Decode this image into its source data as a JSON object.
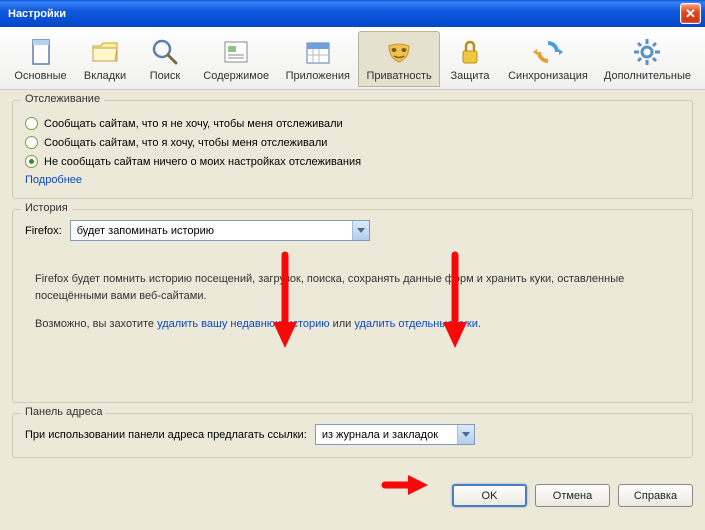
{
  "window": {
    "title": "Настройки"
  },
  "tabs": {
    "main": "Основные",
    "tabsLabel": "Вкладки",
    "search": "Поиск",
    "content": "Содержимое",
    "apps": "Приложения",
    "privacy": "Приватность",
    "security": "Защита",
    "sync": "Синхронизация",
    "advanced": "Дополнительные"
  },
  "tracking": {
    "title": "Отслеживание",
    "opt1": "Сообщать сайтам, что я не хочу, чтобы меня отслеживали",
    "opt2": "Сообщать сайтам, что я хочу, чтобы меня отслеживали",
    "opt3": "Не сообщать сайтам ничего о моих настройках отслеживания",
    "more": "Подробнее"
  },
  "history": {
    "title": "История",
    "firefoxLabel": "Firefox:",
    "mode": "будет запоминать историю",
    "desc": "Firefox будет помнить историю посещений, загрузок, поиска, сохранять данные форм и хранить куки, оставленные посещёнными вами веб-сайтами.",
    "maybeText1": "Возможно, вы захотите ",
    "link1": "удалить вашу недавнюю историю",
    "orText": " или ",
    "link2": "удалить отдельные куки",
    "dot": "."
  },
  "address": {
    "title": "Панель адреса",
    "label": "При использовании панели адреса предлагать ссылки:",
    "value": "из журнала и закладок"
  },
  "buttons": {
    "ok": "OK",
    "cancel": "Отмена",
    "help": "Справка"
  }
}
